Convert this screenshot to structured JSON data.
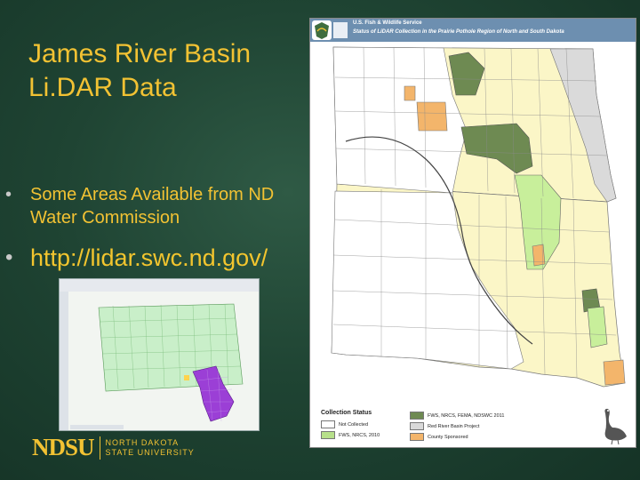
{
  "slide": {
    "title": "James River Basin\nLi.DAR Data",
    "bullets": [
      {
        "text": "Some Areas Available from ND Water Commission"
      },
      {
        "text": "http://lidar.swc.nd.gov/"
      }
    ]
  },
  "fws_map": {
    "agency": "U.S. Fish & Wildlife Service",
    "title": "Status of LiDAR Collection in the Prairie Pothole Region of North and South Dakota",
    "legend": {
      "title": "Collection Status",
      "items": [
        {
          "label": "Not Collected",
          "color": "#ffffff"
        },
        {
          "label": "FWS, NRCS, 2010",
          "color": "#b7e08a"
        },
        {
          "label": "FWS, NRCS, FEMA, NDSWC 2011",
          "color": "#6e8a52"
        },
        {
          "label": "Red River Basin Project",
          "color": "#d9d9d9"
        },
        {
          "label": "County Sponsored",
          "color": "#f3b56b"
        }
      ]
    }
  },
  "footer": {
    "logo_mark": "NDSU",
    "institution": "NORTH DAKOTA\nSTATE UNIVERSITY"
  },
  "colors": {
    "title": "#f2c233",
    "background": "#1f4433",
    "map_yellow": "#fbf6c7",
    "map_light_green": "#c8ef9b",
    "map_dark_green": "#6e8a52",
    "map_orange": "#f3b56b",
    "map_gray": "#dadada",
    "mini_map_purple": "#9b3fd6",
    "mini_map_green": "#b4e8b4"
  }
}
